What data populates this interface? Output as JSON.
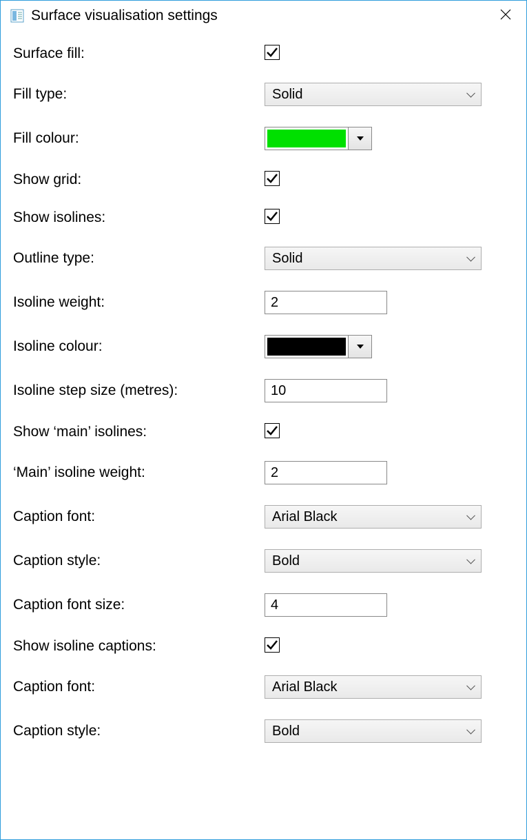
{
  "window": {
    "title": "Surface visualisation settings"
  },
  "fields": {
    "surface_fill": {
      "label": "Surface fill:",
      "checked": true
    },
    "fill_type": {
      "label": "Fill type:",
      "value": "Solid"
    },
    "fill_colour": {
      "label": "Fill colour:",
      "color": "#00e000"
    },
    "show_grid": {
      "label": "Show grid:",
      "checked": true
    },
    "show_isolines": {
      "label": "Show isolines:",
      "checked": true
    },
    "outline_type": {
      "label": "Outline type:",
      "value": "Solid"
    },
    "isoline_weight": {
      "label": "Isoline weight:",
      "value": "2"
    },
    "isoline_colour": {
      "label": "Isoline colour:",
      "color": "#000000"
    },
    "isoline_step": {
      "label": "Isoline step size (metres):",
      "value": "10"
    },
    "show_main_isolines": {
      "label": "Show ‘main’ isolines:",
      "checked": true
    },
    "main_isoline_weight": {
      "label": "‘Main’ isoline weight:",
      "value": "2"
    },
    "caption_font": {
      "label": "Caption font:",
      "value": "Arial Black"
    },
    "caption_style": {
      "label": "Caption style:",
      "value": "Bold"
    },
    "caption_font_size": {
      "label": "Caption font size:",
      "value": "4"
    },
    "show_isoline_captions": {
      "label": "Show isoline captions:",
      "checked": true
    },
    "caption_font2": {
      "label": "Caption font:",
      "value": "Arial Black"
    },
    "caption_style2": {
      "label": "Caption style:",
      "value": "Bold"
    }
  }
}
